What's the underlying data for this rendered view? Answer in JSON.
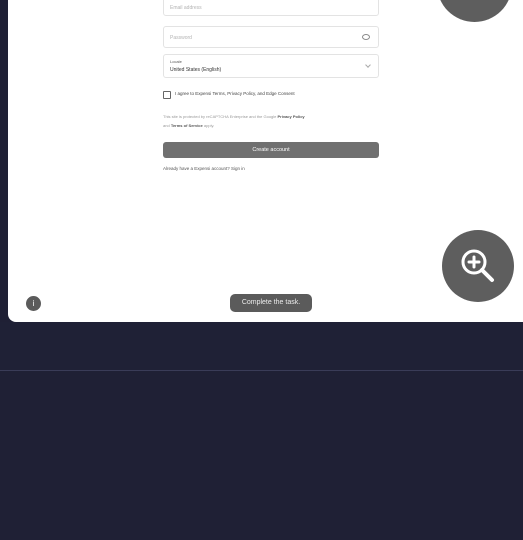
{
  "form": {
    "email_placeholder": "Email address",
    "password_placeholder": "Password",
    "locale_label": "Locale",
    "locale_value": "United States (English)",
    "agree_text": "I agree to Expensi Terms, Privacy Policy, and Edge Consent",
    "notice_text": "This site is protected by reCAPTCHA Enterprise and the Google",
    "privacy_policy": "Privacy Policy",
    "and_text": "and",
    "terms_of_service": "Terms of Service",
    "apply_text": "apply.",
    "create_button": "Create account",
    "signin_text": "Already have a Expensi account? Sign in"
  },
  "overlay": {
    "info_label": "i",
    "task_label": "Complete the task."
  },
  "icons": {
    "zoom_top": "zoom-icon",
    "zoom_main": "zoom-in-icon",
    "password_toggle": "eye-icon",
    "locale_dropdown": "chevron-down-icon"
  },
  "colors": {
    "background": "#1f2035",
    "panel": "#ffffff",
    "button": "#707070",
    "overlay_control": "#5e5e5e"
  }
}
